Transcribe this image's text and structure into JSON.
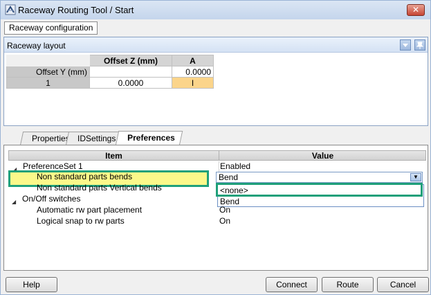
{
  "window": {
    "title": "Raceway Routing Tool / Start",
    "close": "✕"
  },
  "top_tab": {
    "label": "Raceway configuration"
  },
  "layout": {
    "header": "Raceway layout",
    "grid": {
      "col_offset_z": "Offset Z (mm)",
      "col_a": "A",
      "row_offset_y": "Offset Y (mm)",
      "offset_y_a": "0.0000",
      "row1_label": "1",
      "row1_offset_z": "0.0000",
      "row1_a": "I"
    }
  },
  "tabs": [
    {
      "label": "Properties",
      "active": false
    },
    {
      "label": "IDSettings",
      "active": false
    },
    {
      "label": "Preferences",
      "active": true
    }
  ],
  "preferences": {
    "header_item": "Item",
    "header_value": "Value",
    "rows": [
      {
        "item": "PreferenceSet 1",
        "value": "Enabled",
        "level": 0,
        "expander": "◢"
      },
      {
        "item": "Non standard parts bends",
        "value": "Bend",
        "level": 1
      },
      {
        "item": "Non standard parts Vertical bends",
        "value": "",
        "level": 1
      },
      {
        "item": "On/Off switches",
        "value": "",
        "level": 0,
        "expander": "◢"
      },
      {
        "item": "Automatic rw part placement",
        "value": "On",
        "level": 1
      },
      {
        "item": "Logical snap to rw parts",
        "value": "On",
        "level": 1
      }
    ],
    "dropdown_options": [
      "<none>",
      "Bend"
    ],
    "dropdown_arrow": "▼"
  },
  "buttons": {
    "help": "Help",
    "connect": "Connect",
    "route": "Route",
    "cancel": "Cancel"
  },
  "colors": {
    "highlight_green": "#1fa07a",
    "highlight_yellow": "#fbf88a",
    "selected_cell": "#fbd48a"
  }
}
